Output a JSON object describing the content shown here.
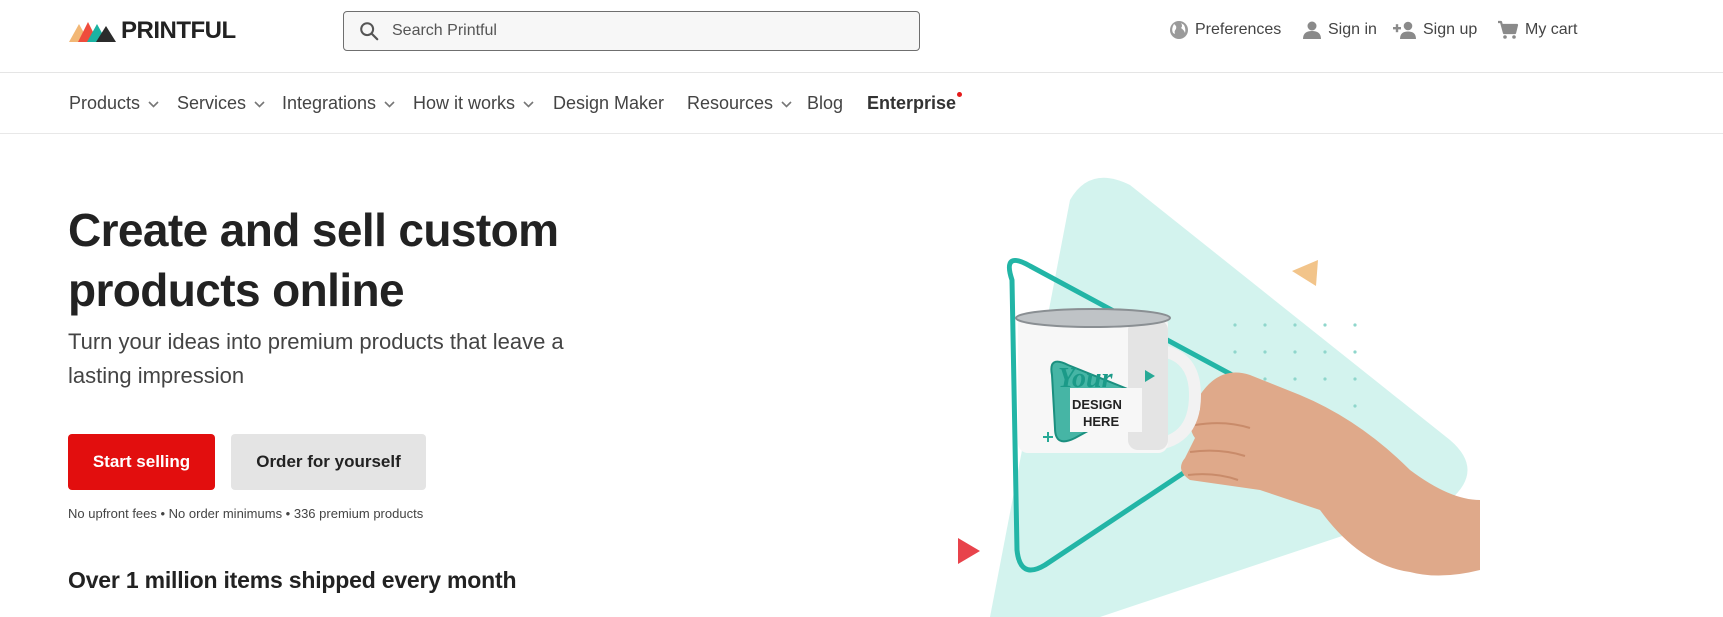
{
  "header": {
    "logo_text": "PRINTFUL",
    "search_placeholder": "Search Printful",
    "utilities": {
      "preferences": "Preferences",
      "sign_in": "Sign in",
      "sign_up": "Sign up",
      "cart": "My cart"
    }
  },
  "nav": {
    "products": "Products",
    "services": "Services",
    "integrations": "Integrations",
    "how_it_works": "How it works",
    "design_maker": "Design Maker",
    "resources": "Resources",
    "blog": "Blog",
    "enterprise": "Enterprise"
  },
  "hero": {
    "title": "Create and sell custom products online",
    "subtitle": "Turn your ideas into premium products that leave a lasting impression",
    "primary_cta": "Start selling",
    "secondary_cta": "Order for yourself",
    "fine_print": "No upfront fees • No order minimums • 336 premium products",
    "shipped_heading": "Over 1 million items shipped every month",
    "mug_text_line1": "Your",
    "mug_text_line2": "DESIGN",
    "mug_text_line3": "HERE"
  },
  "colors": {
    "brand_red": "#e20e0e",
    "teal": "#22b5a6",
    "mint": "#d3f3ee"
  },
  "icons": {
    "search": "search-icon",
    "preferences": "globe-icon",
    "sign_in": "user-icon",
    "sign_up": "user-plus-icon",
    "cart": "cart-icon"
  }
}
